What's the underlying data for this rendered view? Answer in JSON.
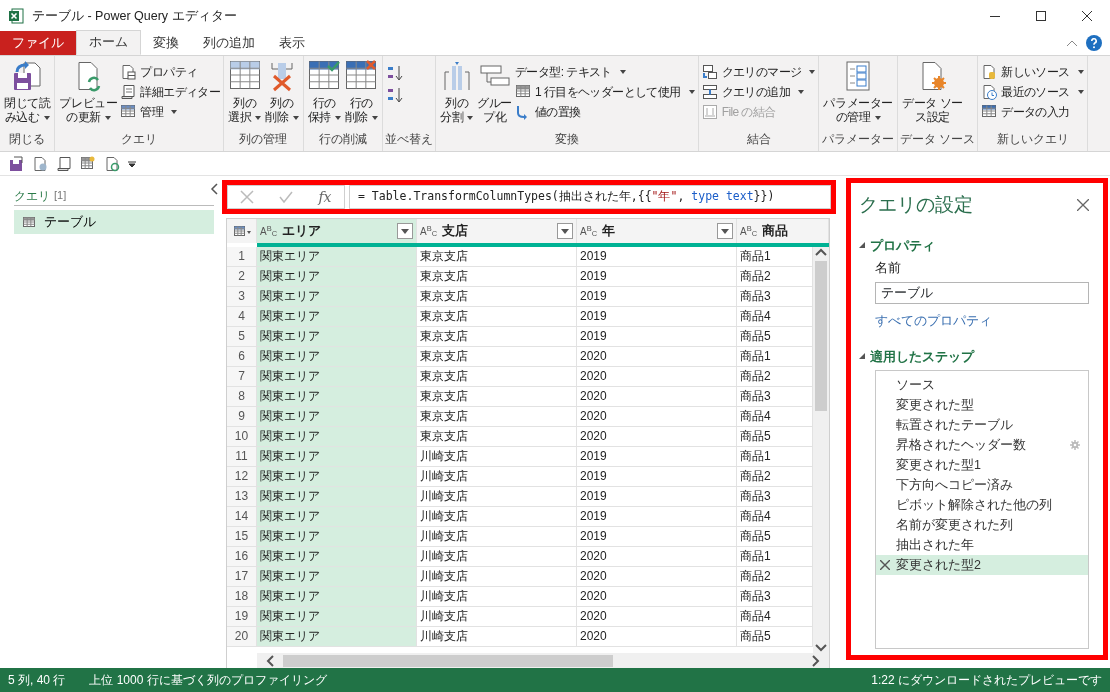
{
  "window": {
    "title": "テーブル - Power Query エディター"
  },
  "ribbon": {
    "tabs": [
      {
        "label": "ファイル",
        "kind": "file",
        "selected": false
      },
      {
        "label": "ホーム",
        "kind": "tab",
        "selected": true
      },
      {
        "label": "変換",
        "kind": "tab",
        "selected": false
      },
      {
        "label": "列の追加",
        "kind": "tab",
        "selected": false
      },
      {
        "label": "表示",
        "kind": "tab",
        "selected": false
      }
    ],
    "groups": [
      {
        "label": "閉じる",
        "items": [
          {
            "kind": "large",
            "label_lines": [
              "閉じて読",
              "み込む"
            ],
            "dropdown": true
          }
        ]
      },
      {
        "label": "クエリ",
        "items": [
          {
            "kind": "large",
            "label_lines": [
              "プレビュー",
              "の更新"
            ],
            "dropdown": true
          },
          {
            "kind": "small",
            "label": "プロパティ",
            "dropdown": false
          },
          {
            "kind": "small",
            "label": "詳細エディター",
            "dropdown": false
          },
          {
            "kind": "small",
            "label": "管理",
            "dropdown": true
          }
        ]
      },
      {
        "label": "列の管理",
        "items": [
          {
            "kind": "large",
            "label_lines": [
              "列の",
              "選択"
            ],
            "dropdown": true
          },
          {
            "kind": "large",
            "label_lines": [
              "列の",
              "削除"
            ],
            "dropdown": true
          }
        ]
      },
      {
        "label": "行の削減",
        "items": [
          {
            "kind": "large",
            "label_lines": [
              "行の",
              "保持"
            ],
            "dropdown": true
          },
          {
            "kind": "large",
            "label_lines": [
              "行の",
              "削除"
            ],
            "dropdown": true
          }
        ]
      },
      {
        "label": "並べ替え",
        "items": [
          {
            "kind": "icon"
          },
          {
            "kind": "icon"
          }
        ]
      },
      {
        "label": "変換",
        "items": [
          {
            "kind": "large",
            "label_lines": [
              "列の",
              "分割"
            ],
            "dropdown": true
          },
          {
            "kind": "large",
            "label_lines": [
              "グルー",
              "プ化"
            ],
            "dropdown": false
          },
          {
            "kind": "small",
            "label": "データ型: テキスト",
            "dropdown": true
          },
          {
            "kind": "small",
            "label": "1 行目をヘッダーとして使用",
            "dropdown": true
          },
          {
            "kind": "small",
            "label": "値の置換",
            "dropdown": false
          }
        ]
      },
      {
        "label": "結合",
        "items": [
          {
            "kind": "small",
            "label": "クエリのマージ",
            "dropdown": true
          },
          {
            "kind": "small",
            "label": "クエリの追加",
            "dropdown": true
          },
          {
            "kind": "small",
            "label": "File の結合",
            "dropdown": false,
            "disabled": true
          }
        ]
      },
      {
        "label": "パラメーター",
        "items": [
          {
            "kind": "large",
            "label_lines": [
              "パラメーター",
              "の管理"
            ],
            "dropdown": true
          }
        ]
      },
      {
        "label": "データ ソース",
        "items": [
          {
            "kind": "large",
            "label_lines": [
              "データ ソー",
              "ス設定"
            ],
            "dropdown": false
          }
        ]
      },
      {
        "label": "新しいクエリ",
        "items": [
          {
            "kind": "small",
            "label": "新しいソース",
            "dropdown": true
          },
          {
            "kind": "small",
            "label": "最近のソース",
            "dropdown": true
          },
          {
            "kind": "small",
            "label": "データの入力",
            "dropdown": false
          }
        ]
      }
    ]
  },
  "queries_pane": {
    "title": "クエリ",
    "count": "[1]",
    "items": [
      {
        "label": "テーブル",
        "selected": true
      }
    ]
  },
  "formula_bar": {
    "highlighted": true,
    "fx_label": "fx",
    "tokens": [
      {
        "text": "= Table.TransformColumnTypes(抽出された年,{{",
        "kind": "plain"
      },
      {
        "text": "\"年\"",
        "kind": "string"
      },
      {
        "text": ", ",
        "kind": "plain"
      },
      {
        "text": "type text",
        "kind": "keyword"
      },
      {
        "text": "}})",
        "kind": "plain"
      }
    ]
  },
  "table": {
    "columns": [
      {
        "name": "エリア",
        "type_label": "A$^{B}$$_{C}$",
        "selected": true,
        "filter_button": true
      },
      {
        "name": "支店",
        "type_label": "A$^{B}$$_{C}$",
        "selected": false,
        "filter_button": true
      },
      {
        "name": "年",
        "type_label": "A$^{B}$$_{C}$",
        "selected": false,
        "filter_button": true
      },
      {
        "name": "商品",
        "type_label": "A$^{B}$$_{C}$",
        "selected": false,
        "filter_button": false
      }
    ],
    "rows": [
      {
        "number": "1",
        "cells": [
          "関東エリア",
          "東京支店",
          "2019",
          "商品1"
        ]
      },
      {
        "number": "2",
        "cells": [
          "関東エリア",
          "東京支店",
          "2019",
          "商品2"
        ]
      },
      {
        "number": "3",
        "cells": [
          "関東エリア",
          "東京支店",
          "2019",
          "商品3"
        ]
      },
      {
        "number": "4",
        "cells": [
          "関東エリア",
          "東京支店",
          "2019",
          "商品4"
        ]
      },
      {
        "number": "5",
        "cells": [
          "関東エリア",
          "東京支店",
          "2019",
          "商品5"
        ]
      },
      {
        "number": "6",
        "cells": [
          "関東エリア",
          "東京支店",
          "2020",
          "商品1"
        ]
      },
      {
        "number": "7",
        "cells": [
          "関東エリア",
          "東京支店",
          "2020",
          "商品2"
        ]
      },
      {
        "number": "8",
        "cells": [
          "関東エリア",
          "東京支店",
          "2020",
          "商品3"
        ]
      },
      {
        "number": "9",
        "cells": [
          "関東エリア",
          "東京支店",
          "2020",
          "商品4"
        ]
      },
      {
        "number": "10",
        "cells": [
          "関東エリア",
          "東京支店",
          "2020",
          "商品5"
        ]
      },
      {
        "number": "11",
        "cells": [
          "関東エリア",
          "川崎支店",
          "2019",
          "商品1"
        ]
      },
      {
        "number": "12",
        "cells": [
          "関東エリア",
          "川崎支店",
          "2019",
          "商品2"
        ]
      },
      {
        "number": "13",
        "cells": [
          "関東エリア",
          "川崎支店",
          "2019",
          "商品3"
        ]
      },
      {
        "number": "14",
        "cells": [
          "関東エリア",
          "川崎支店",
          "2019",
          "商品4"
        ]
      },
      {
        "number": "15",
        "cells": [
          "関東エリア",
          "川崎支店",
          "2019",
          "商品5"
        ]
      },
      {
        "number": "16",
        "cells": [
          "関東エリア",
          "川崎支店",
          "2020",
          "商品1"
        ]
      },
      {
        "number": "17",
        "cells": [
          "関東エリア",
          "川崎支店",
          "2020",
          "商品2"
        ]
      },
      {
        "number": "18",
        "cells": [
          "関東エリア",
          "川崎支店",
          "2020",
          "商品3"
        ]
      },
      {
        "number": "19",
        "cells": [
          "関東エリア",
          "川崎支店",
          "2020",
          "商品4"
        ]
      },
      {
        "number": "20",
        "cells": [
          "関東エリア",
          "川崎支店",
          "2020",
          "商品5"
        ]
      }
    ]
  },
  "query_settings": {
    "title": "クエリの設定",
    "highlighted": true,
    "properties": {
      "heading": "プロパティ",
      "name_label": "名前",
      "name_value": "テーブル",
      "link": "すべてのプロパティ"
    },
    "steps": {
      "heading": "適用したステップ",
      "items": [
        {
          "label": "ソース",
          "selected": false,
          "has_settings": false
        },
        {
          "label": "変更された型",
          "selected": false,
          "has_settings": false
        },
        {
          "label": "転置されたテーブル",
          "selected": false,
          "has_settings": false
        },
        {
          "label": "昇格されたヘッダー数",
          "selected": false,
          "has_settings": true
        },
        {
          "label": "変更された型1",
          "selected": false,
          "has_settings": false
        },
        {
          "label": "下方向へコピー済み",
          "selected": false,
          "has_settings": false
        },
        {
          "label": "ピボット解除された他の列",
          "selected": false,
          "has_settings": false
        },
        {
          "label": "名前が変更された列",
          "selected": false,
          "has_settings": false
        },
        {
          "label": "抽出された年",
          "selected": false,
          "has_settings": false
        },
        {
          "label": "変更された型2",
          "selected": true,
          "has_settings": false
        }
      ]
    }
  },
  "status_bar": {
    "left": [
      "5 列, 40 行",
      "上位 1000 行に基づく列のプロファイリング"
    ],
    "right": "1:22 にダウンロードされたプレビューです"
  }
}
